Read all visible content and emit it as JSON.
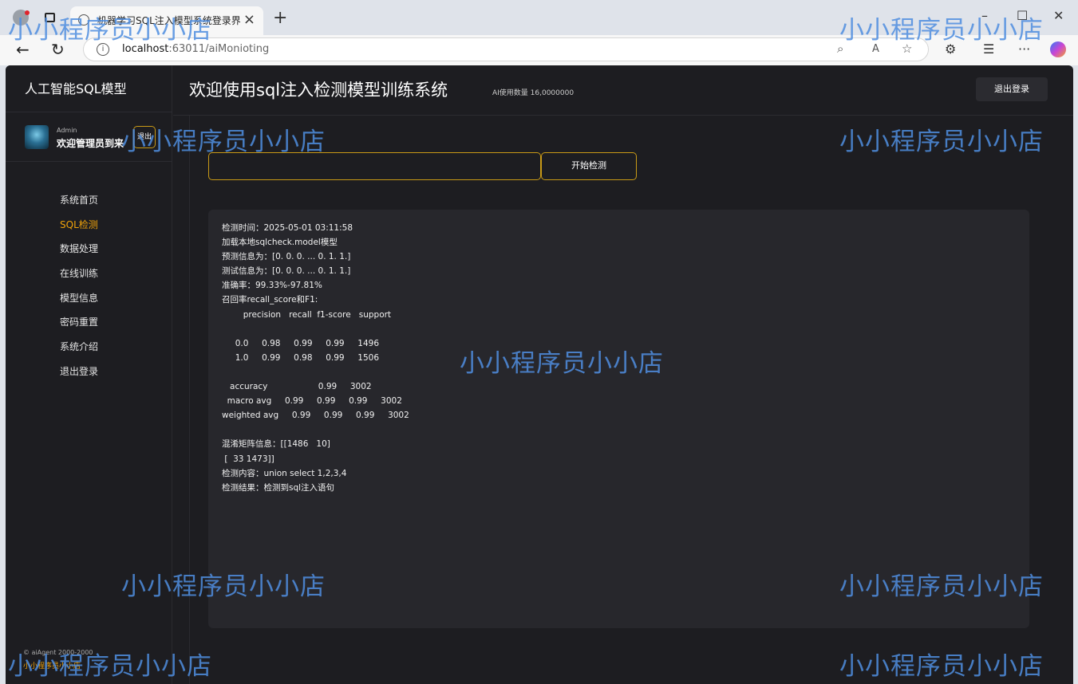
{
  "browser": {
    "tab_title": "机器学习SQL注入模型系统登录界",
    "url_host": "localhost",
    "url_rest": ":63011/aiMonioting",
    "win_min": "–",
    "win_max": "☐",
    "win_close": "✕"
  },
  "sidebar": {
    "brand": "人工智能SQL模型",
    "user_role": "Admin",
    "user_welcome": "欢迎管理员到来",
    "logout_small": "退出",
    "items": [
      {
        "label": "系统首页"
      },
      {
        "label": "SQL检测"
      },
      {
        "label": "数据处理"
      },
      {
        "label": "在线训练"
      },
      {
        "label": "模型信息"
      },
      {
        "label": "密码重置"
      },
      {
        "label": "系统介绍"
      },
      {
        "label": "退出登录"
      }
    ],
    "active_index": 1,
    "copyright": "© aiAgent 2000-2000",
    "shop": "小小程序员小小店"
  },
  "header": {
    "title": "欢迎使用sql注入检测模型训练系统",
    "usage": "AI使用数量 16,0000000",
    "logout": "退出登录"
  },
  "detect": {
    "input_value": "",
    "button": "开始检测"
  },
  "result": {
    "lines": [
      "检测时间：2025-05-01 03:11:58",
      "加载本地sqlcheck.model模型",
      "预测信息为：[0. 0. 0. ... 0. 1. 1.]",
      "测试信息为：[0. 0. 0. ... 0. 1. 1.]",
      "准确率：99.33%-97.81%",
      "召回率recall_score和F1:",
      "        precision   recall  f1-score   support",
      "",
      "     0.0     0.98     0.99     0.99     1496",
      "     1.0     0.99     0.98     0.99     1506",
      "",
      "   accuracy                   0.99     3002",
      "  macro avg     0.99     0.99     0.99     3002",
      "weighted avg     0.99     0.99     0.99     3002",
      "",
      "混淆矩阵信息：[[1486   10]",
      " [  33 1473]]",
      "检测内容：union select 1,2,3,4",
      "检测结果：检测到sql注入语句"
    ]
  },
  "watermark": "小小程序员小小店",
  "colors": {
    "accent": "#f0a30a",
    "border_gold": "#c99a16",
    "bg": "#1d1d21",
    "panel": "#27272c",
    "watermark": "#4f8ee0"
  }
}
